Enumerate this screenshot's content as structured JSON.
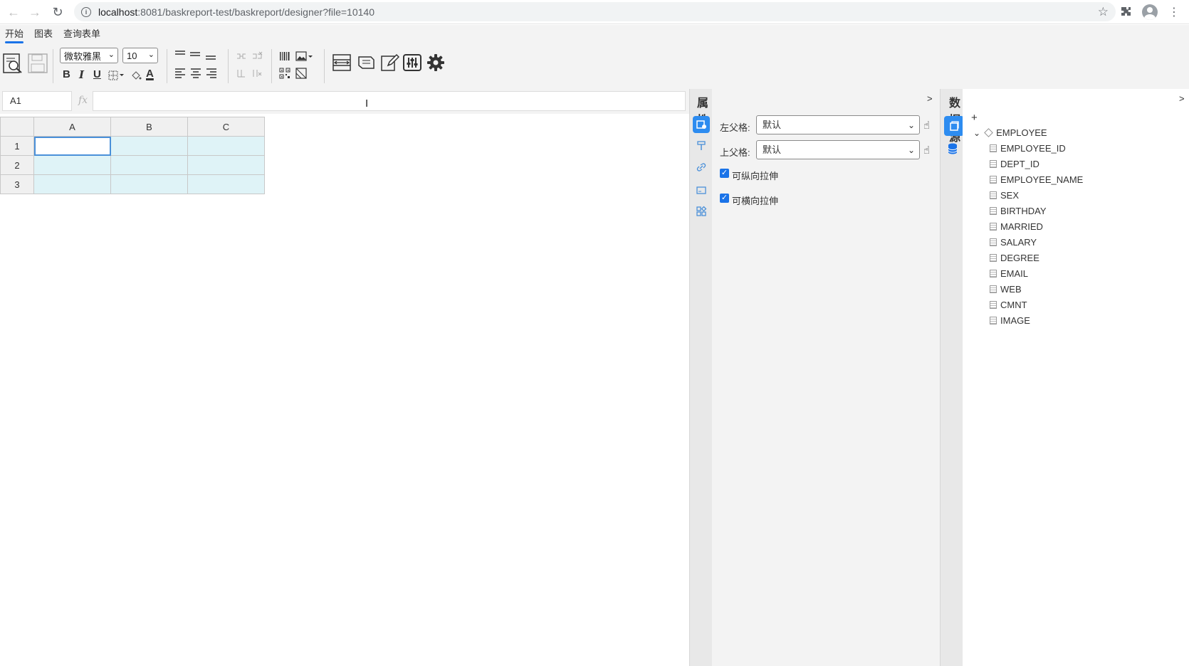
{
  "browser": {
    "url_host": "localhost",
    "url_rest": ":8081/baskreport-test/baskreport/designer?file=10140"
  },
  "menu": {
    "tabs": [
      {
        "label": "开始",
        "active": true
      },
      {
        "label": "图表",
        "active": false
      },
      {
        "label": "查询表单",
        "active": false
      }
    ]
  },
  "toolbar": {
    "font_family": "微软雅黑",
    "font_size": "10",
    "bold": "B",
    "italic": "I",
    "underline": "U",
    "font_color": "A"
  },
  "formula_bar": {
    "cell_ref": "A1",
    "fx_label": "fx",
    "formula": ""
  },
  "grid": {
    "columns": [
      "A",
      "B",
      "C"
    ],
    "rows": [
      "1",
      "2",
      "3"
    ],
    "selected_cell": "A1"
  },
  "properties_panel": {
    "title": "属性",
    "collapse": ">",
    "left_parent_label": "左父格:",
    "left_parent_value": "默认",
    "top_parent_label": "上父格:",
    "top_parent_value": "默认",
    "vertical_stretch_label": "可纵向拉伸",
    "vertical_stretch_checked": true,
    "horizontal_stretch_label": "可横向拉伸",
    "horizontal_stretch_checked": true
  },
  "datasource_panel": {
    "title": "数据源",
    "collapse": ">",
    "add": "+",
    "dataset": "EMPLOYEE",
    "fields": [
      "EMPLOYEE_ID",
      "DEPT_ID",
      "EMPLOYEE_NAME",
      "SEX",
      "BIRTHDAY",
      "MARRIED",
      "SALARY",
      "DEGREE",
      "EMAIL",
      "WEB",
      "CMNT",
      "IMAGE"
    ]
  },
  "colors": {
    "accent": "#1a73e8",
    "cell_fill": "#dff3f7",
    "panel_bg": "#f3f3f3"
  }
}
